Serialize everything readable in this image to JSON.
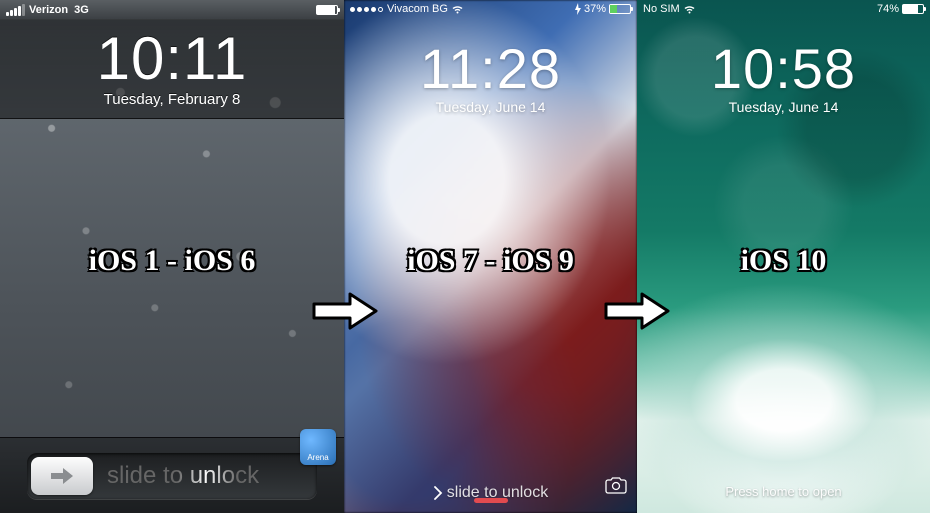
{
  "panels": {
    "ios6": {
      "caption": "iOS 1 - iOS 6",
      "status": {
        "carrier": "Verizon",
        "network": "3G"
      },
      "time": "10:11",
      "date": "Tuesday, February 8",
      "slide_label": "slide to unlock",
      "arena_badge": "Arena"
    },
    "ios9": {
      "caption": "iOS 7 - iOS 9",
      "status": {
        "carrier": "Vivacom BG",
        "battery_pct": "37%"
      },
      "time": "11:28",
      "date": "Tuesday, June 14",
      "slide_label": "slide to unlock"
    },
    "ios10": {
      "caption": "iOS 10",
      "status": {
        "carrier": "No SIM",
        "battery_pct": "74%"
      },
      "time": "10:58",
      "date": "Tuesday, June 14",
      "press_label": "Press home to open"
    }
  }
}
